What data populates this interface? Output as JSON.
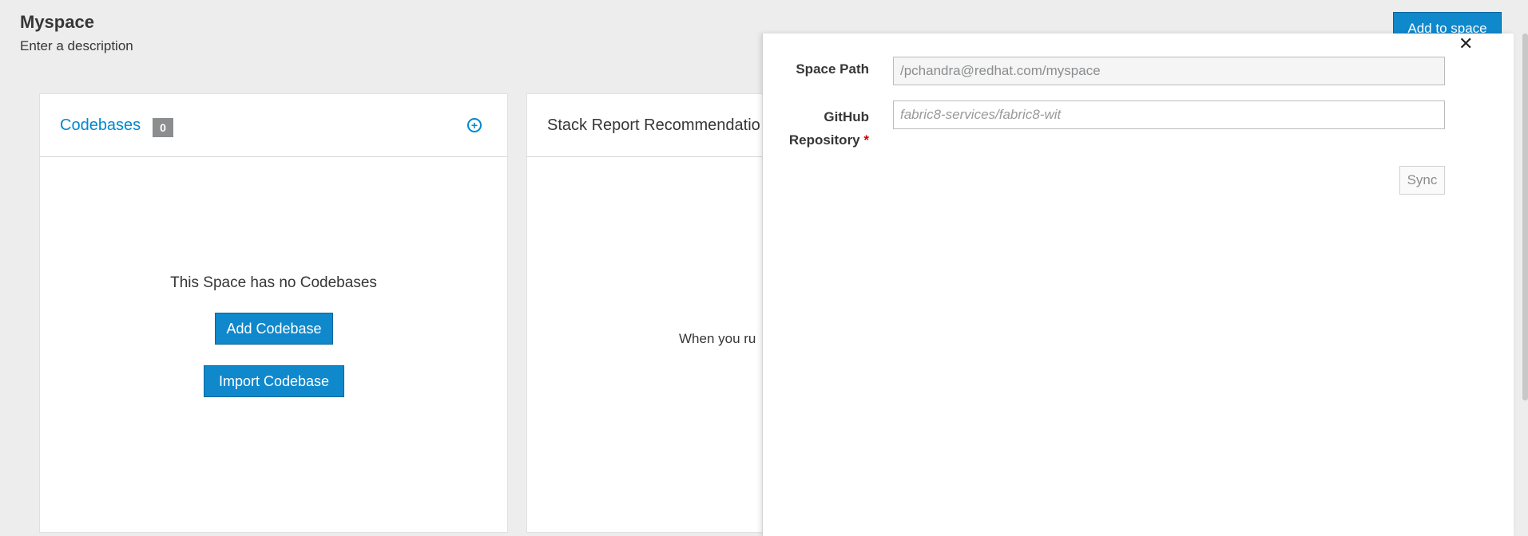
{
  "space": {
    "title": "Myspace",
    "description": "Enter a description"
  },
  "header": {
    "add_to_space": "Add to space"
  },
  "codebases": {
    "title": "Codebases",
    "count": "0",
    "empty_message": "This Space has no Codebases",
    "add_button": "Add Codebase",
    "import_button": "Import Codebase"
  },
  "stack": {
    "title": "Stack Report Recommendatio",
    "message": "When you ru"
  },
  "panel": {
    "space_path_label": "Space Path",
    "space_path_value": "/pchandra@redhat.com/myspace",
    "repo_label_1": "GitHub",
    "repo_label_2": "Repository",
    "repo_required": "*",
    "repo_placeholder": "fabric8-services/fabric8-wit",
    "sync_button": "Sync",
    "close": "✕"
  }
}
